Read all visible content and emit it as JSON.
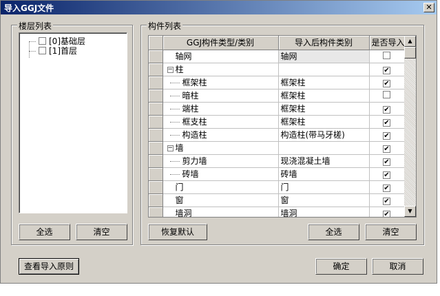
{
  "window": {
    "title": "导入GGJ文件"
  },
  "floor_panel": {
    "label": "楼层列表",
    "items": [
      {
        "label": "[0]基础层",
        "checked": false
      },
      {
        "label": "[1]首层",
        "checked": false
      }
    ],
    "select_all": "全选",
    "clear": "清空"
  },
  "component_panel": {
    "label": "构件列表",
    "columns": [
      "GGJ构件类型/类别",
      "导入后构件类别",
      "是否导入"
    ],
    "rows": [
      {
        "name": "轴网",
        "target": "轴网",
        "checked": false,
        "level": 0,
        "group": false
      },
      {
        "name": "柱",
        "target": "",
        "checked": true,
        "level": 0,
        "group": true
      },
      {
        "name": "框架柱",
        "target": "框架柱",
        "checked": true,
        "level": 1,
        "group": false
      },
      {
        "name": "暗柱",
        "target": "框架柱",
        "checked": false,
        "level": 1,
        "group": false
      },
      {
        "name": "端柱",
        "target": "框架柱",
        "checked": true,
        "level": 1,
        "group": false
      },
      {
        "name": "框支柱",
        "target": "框架柱",
        "checked": true,
        "level": 1,
        "group": false
      },
      {
        "name": "构造柱",
        "target": "构造柱(带马牙槎)",
        "checked": true,
        "level": 1,
        "group": false
      },
      {
        "name": "墙",
        "target": "",
        "checked": true,
        "level": 0,
        "group": true
      },
      {
        "name": "剪力墙",
        "target": "现浇混凝土墙",
        "checked": true,
        "level": 1,
        "group": false
      },
      {
        "name": "砖墙",
        "target": "砖墙",
        "checked": true,
        "level": 1,
        "group": false
      },
      {
        "name": "门",
        "target": "门",
        "checked": true,
        "level": 0,
        "group": false
      },
      {
        "name": "窗",
        "target": "窗",
        "checked": true,
        "level": 0,
        "group": false
      },
      {
        "name": "墙洞",
        "target": "墙洞",
        "checked": true,
        "level": 0,
        "group": false
      }
    ],
    "restore_default": "恢复默认",
    "select_all": "全选",
    "clear": "清空"
  },
  "footer": {
    "view_rules": "查看导入原则",
    "ok": "确定",
    "cancel": "取消"
  },
  "colors": {
    "title_start": "#0a246a",
    "title_end": "#a6caf0",
    "face": "#d4d0c8"
  }
}
